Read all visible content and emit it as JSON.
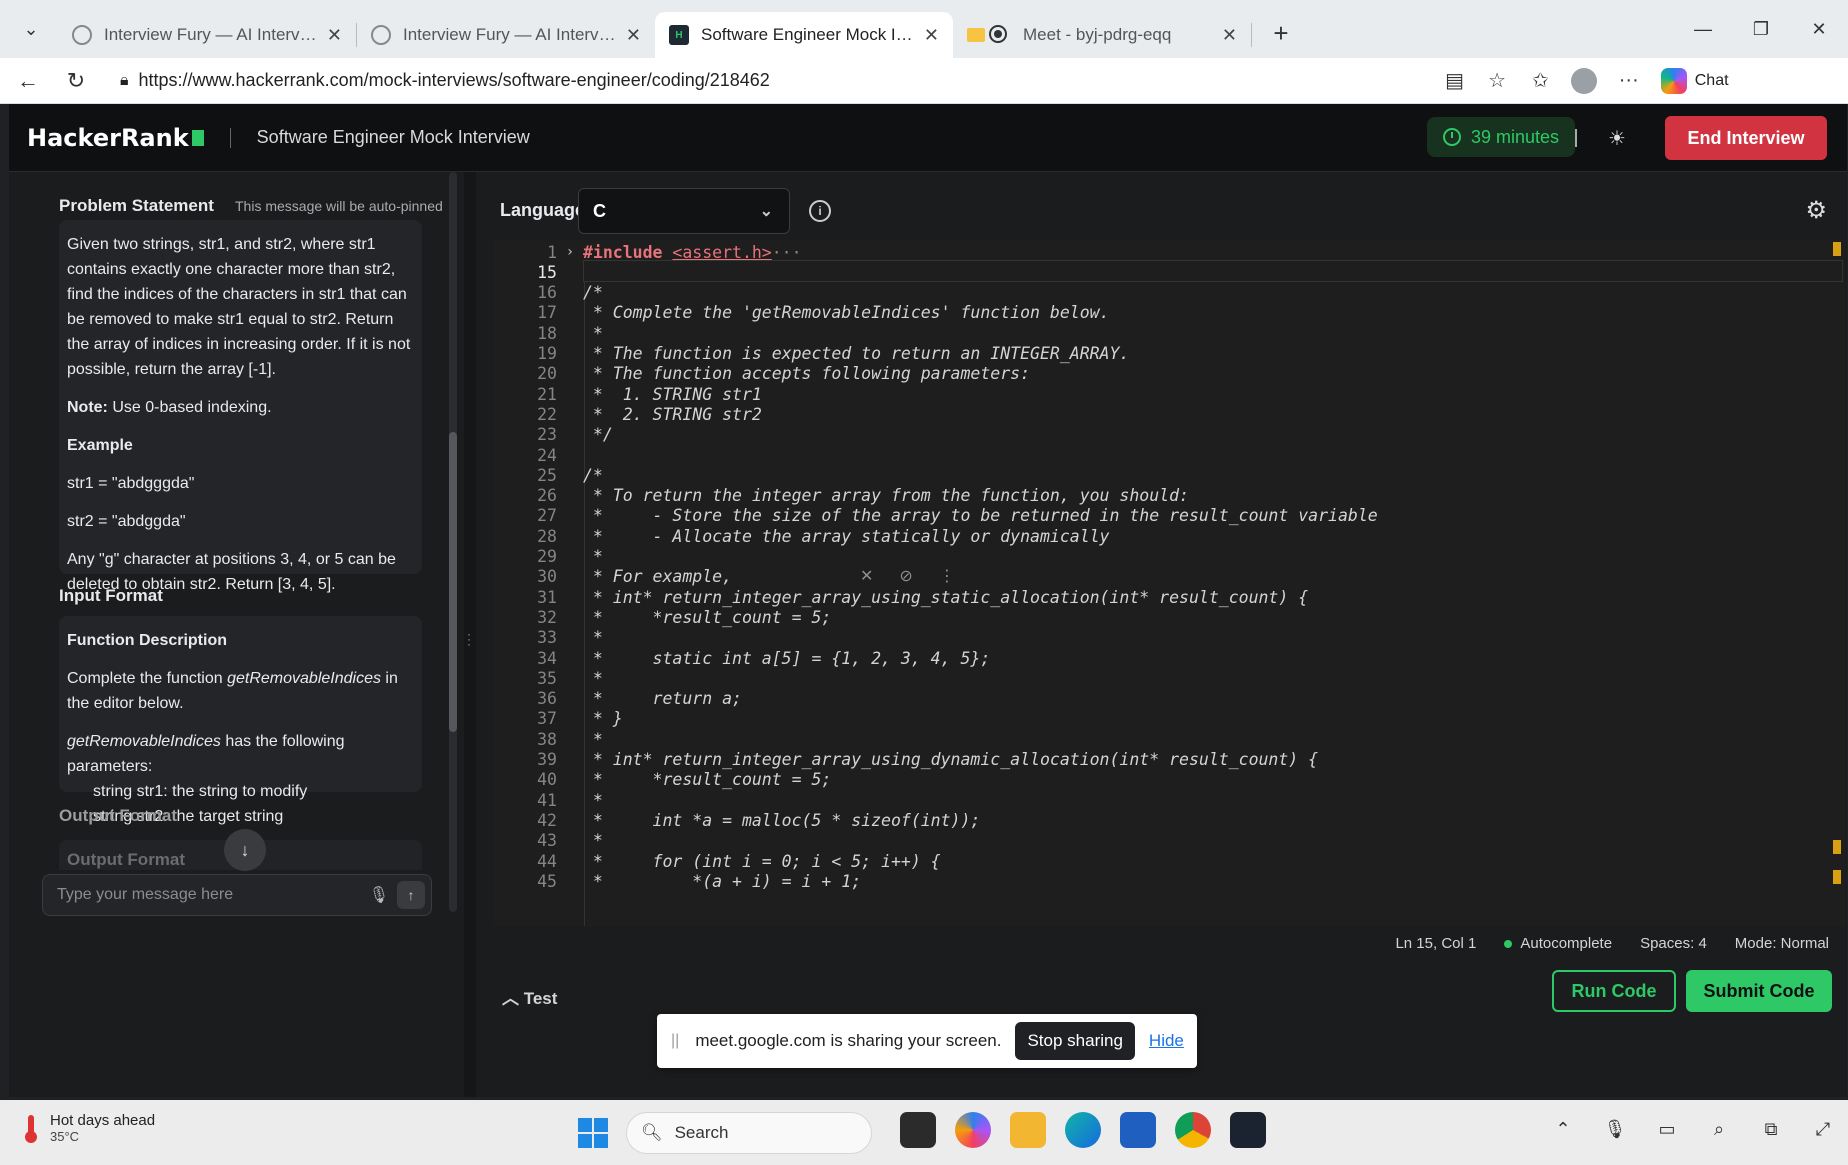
{
  "browser": {
    "tabs": [
      {
        "title": "Interview Fury — AI Interview Assi",
        "active": false
      },
      {
        "title": "Interview Fury — AI Interview Assi",
        "active": false
      },
      {
        "title": "Software Engineer Mock Interview",
        "active": true
      },
      {
        "title": "Meet - byj-pdrg-eqq",
        "active": false
      }
    ],
    "url": "https://www.hackerrank.com/mock-interviews/software-engineer/coding/218462",
    "chat_label": "Chat"
  },
  "header": {
    "logo": "HackerRank",
    "title": "Software Engineer Mock Interview",
    "timer": "39 minutes",
    "end_button": "End Interview"
  },
  "chat": {
    "problem_header": "Problem Statement",
    "autopin_note": "This message will be auto-pinned",
    "problem_text": "Given two strings, str1, and str2, where str1 contains exactly one character more than str2, find the indices of the characters in str1 that can be removed to make str1 equal to str2. Return the array of indices in increasing order. If it is not possible, return the array [-1].",
    "note_label": "Note:",
    "note_text": " Use 0-based indexing.",
    "example_label": "Example",
    "example_str1": "str1 = \"abdgggda\"",
    "example_str2": "str2 = \"abdggda\"",
    "example_explain": "Any \"g\" character at positions 3, 4, or 5 can be deleted to obtain str2. Return [3, 4, 5].",
    "input_format_title": "Input Format",
    "func_desc_title": "Function Description",
    "func_desc_pre": "Complete the function ",
    "func_name": "getRemovableIndices",
    "func_desc_post": " in the editor below.",
    "params_func": "getRemovableIndices",
    "params_post": " has the following parameters:",
    "param1": "string str1: the string to modify",
    "param2": "string str2: the target string",
    "output_format_title": "Output Format",
    "output_format_faded": "Output Format",
    "input_placeholder": "Type your message here"
  },
  "editor": {
    "language_label": "Language",
    "language_value": "C",
    "lines": [
      {
        "n": "1",
        "fold": "›",
        "include": true,
        "pre": "#include ",
        "hdr": "<assert.h>",
        "rest": "···"
      },
      {
        "n": "15",
        "cur": true,
        "text": ""
      },
      {
        "n": "16",
        "text": "/*"
      },
      {
        "n": "17",
        "text": " * Complete the 'getRemovableIndices' function below."
      },
      {
        "n": "18",
        "text": " *"
      },
      {
        "n": "19",
        "text": " * The function is expected to return an INTEGER_ARRAY."
      },
      {
        "n": "20",
        "text": " * The function accepts following parameters:"
      },
      {
        "n": "21",
        "text": " *  1. STRING str1"
      },
      {
        "n": "22",
        "text": " *  2. STRING str2"
      },
      {
        "n": "23",
        "text": " */"
      },
      {
        "n": "24",
        "text": ""
      },
      {
        "n": "25",
        "text": "/*"
      },
      {
        "n": "26",
        "text": " * To return the integer array from the function, you should:"
      },
      {
        "n": "27",
        "text": " *     - Store the size of the array to be returned in the result_count variable"
      },
      {
        "n": "28",
        "text": " *     - Allocate the array statically or dynamically"
      },
      {
        "n": "29",
        "text": " *"
      },
      {
        "n": "30",
        "text": " * For example,"
      },
      {
        "n": "31",
        "text": " * int* return_integer_array_using_static_allocation(int* result_count) {"
      },
      {
        "n": "32",
        "text": " *     *result_count = 5;"
      },
      {
        "n": "33",
        "text": " *"
      },
      {
        "n": "34",
        "text": " *     static int a[5] = {1, 2, 3, 4, 5};"
      },
      {
        "n": "35",
        "text": " *"
      },
      {
        "n": "36",
        "text": " *     return a;"
      },
      {
        "n": "37",
        "text": " * }"
      },
      {
        "n": "38",
        "text": " *"
      },
      {
        "n": "39",
        "text": " * int* return_integer_array_using_dynamic_allocation(int* result_count) {"
      },
      {
        "n": "40",
        "text": " *     *result_count = 5;"
      },
      {
        "n": "41",
        "text": " *"
      },
      {
        "n": "42",
        "text": " *     int *a = malloc(5 * sizeof(int));"
      },
      {
        "n": "43",
        "text": " *"
      },
      {
        "n": "44",
        "text": " *     for (int i = 0; i < 5; i++) {"
      },
      {
        "n": "45",
        "text": " *         *(a + i) = i + 1;"
      }
    ],
    "status": {
      "position": "Ln 15, Col 1",
      "autocomplete": "Autocomplete",
      "spaces": "Spaces: 4",
      "mode": "Mode: Normal"
    },
    "test_label": "Test",
    "run_button": "Run Code",
    "submit_button": "Submit Code"
  },
  "share": {
    "message": "meet.google.com is sharing your screen.",
    "stop_button": "Stop sharing",
    "hide_link": "Hide"
  },
  "taskbar": {
    "weather_title": "Hot days ahead",
    "weather_temp": "35°C",
    "search_label": "Search"
  }
}
